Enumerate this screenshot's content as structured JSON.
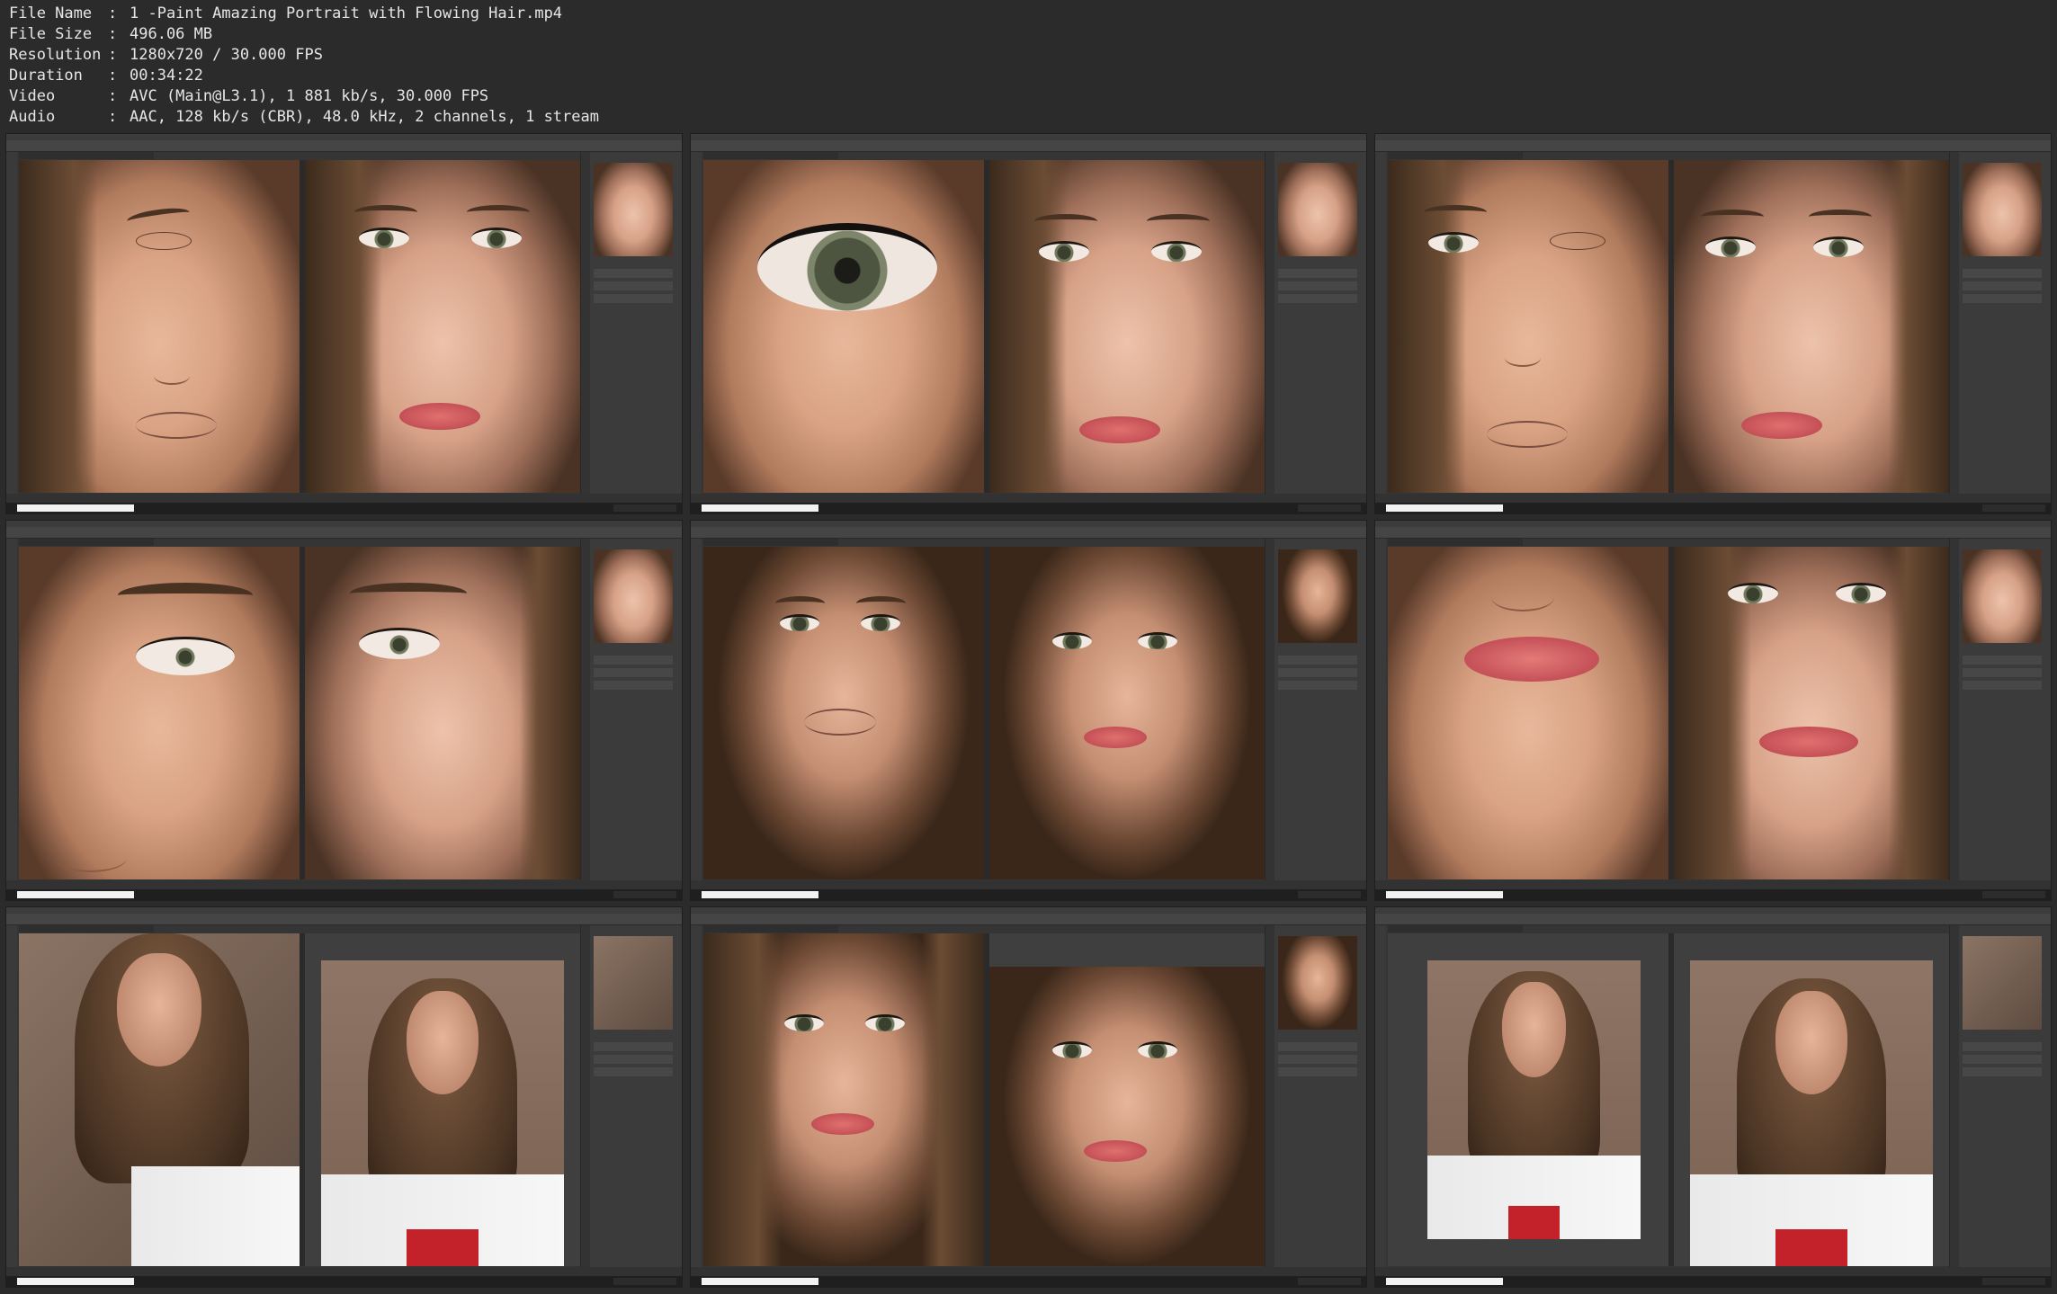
{
  "info": {
    "rows": [
      {
        "label": "File Name",
        "value": "1 -Paint Amazing Portrait with Flowing Hair.mp4"
      },
      {
        "label": "File Size",
        "value": "496.06 MB"
      },
      {
        "label": "Resolution",
        "value": "1280x720 / 30.000 FPS"
      },
      {
        "label": "Duration",
        "value": "00:34:22"
      },
      {
        "label": "Video",
        "value": "AVC (Main@L3.1), 1 881 kb/s, 30.000 FPS"
      },
      {
        "label": "Audio",
        "value": "AAC, 128 kb/s (CBR), 48.0 kHz, 2 channels, 1 stream"
      }
    ],
    "separator": ":"
  },
  "colors": {
    "background": "#2b2b2b",
    "info_text": "#e6e6e6",
    "photoshop_panel": "#3b3b3b",
    "taskbar": "#1f1f1f"
  },
  "thumbnails": [
    {
      "left": "sketch-closeup",
      "right": "photo-closeup"
    },
    {
      "left": "painted-eye-macro",
      "right": "photo-closeup"
    },
    {
      "left": "sketch-with-eye",
      "right": "photo-earrings"
    },
    {
      "left": "eye-brow-detail",
      "right": "photo-eye-ear"
    },
    {
      "left": "painted-face-sketch",
      "right": "photo-earrings"
    },
    {
      "left": "painted-lips",
      "right": "photo-closeup"
    },
    {
      "left": "full-painting-blurred",
      "right": "full-photo"
    },
    {
      "left": "painting-hair",
      "right": "photo-earrings"
    },
    {
      "left": "full-painting-framed",
      "right": "full-photo"
    }
  ]
}
